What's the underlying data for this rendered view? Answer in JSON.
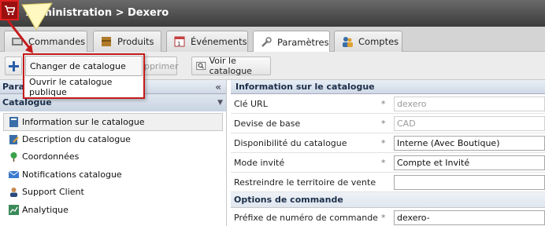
{
  "title": "Administration > Dexero",
  "tabs": [
    {
      "label": "Commandes",
      "icon": "orders-icon"
    },
    {
      "label": "Produits",
      "icon": "products-icon"
    },
    {
      "label": "Événements",
      "icon": "events-icon"
    },
    {
      "label": "Paramètres",
      "icon": "settings-icon"
    },
    {
      "label": "Comptes",
      "icon": "accounts-icon"
    }
  ],
  "toolbar": {
    "add_icon": "plus-icon",
    "delete_label": "upprimer",
    "view_catalog_label": "Voir le catalogue"
  },
  "dropdown": {
    "items": [
      "Changer de catalogue",
      "Ouvrir le catalogue publique"
    ]
  },
  "left_panel": {
    "header": "Para",
    "collapse_glyph": "«",
    "section": "Catalogue",
    "section_toggle": "▼",
    "items": [
      {
        "label": "Information sur le catalogue",
        "icon": "info-icon",
        "selected": true
      },
      {
        "label": "Description du catalogue",
        "icon": "edit-icon"
      },
      {
        "label": "Coordonnées",
        "icon": "map-pin-icon"
      },
      {
        "label": "Notifications catalogue",
        "icon": "notification-icon"
      },
      {
        "label": "Support Client",
        "icon": "support-user-icon"
      },
      {
        "label": "Analytique",
        "icon": "analytics-icon"
      }
    ]
  },
  "form": {
    "header": "Information sur le catalogue",
    "rows": [
      {
        "label": "Clé URL",
        "required": "*",
        "value": "dexero",
        "readonly": true
      },
      {
        "label": "Devise de base",
        "required": "*",
        "value": "CAD",
        "readonly": true
      },
      {
        "label": "Disponibilité du catalogue",
        "required": "*",
        "value": "Interne (Avec Boutique)"
      },
      {
        "label": "Mode invité",
        "required": "*",
        "value": "Compte et Invité"
      },
      {
        "label": "Restreindre le territoire de vente",
        "required": "",
        "value": ""
      }
    ],
    "subheader": "Options de commande",
    "sub_rows": [
      {
        "label": "Préfixe de numéro de commande",
        "required": "*",
        "value": "dexero-"
      }
    ]
  },
  "colors": {
    "accent_red": "#c41a1a",
    "highlight_yellow": "#fff8c0",
    "title_bar": "#4a4a4a"
  }
}
